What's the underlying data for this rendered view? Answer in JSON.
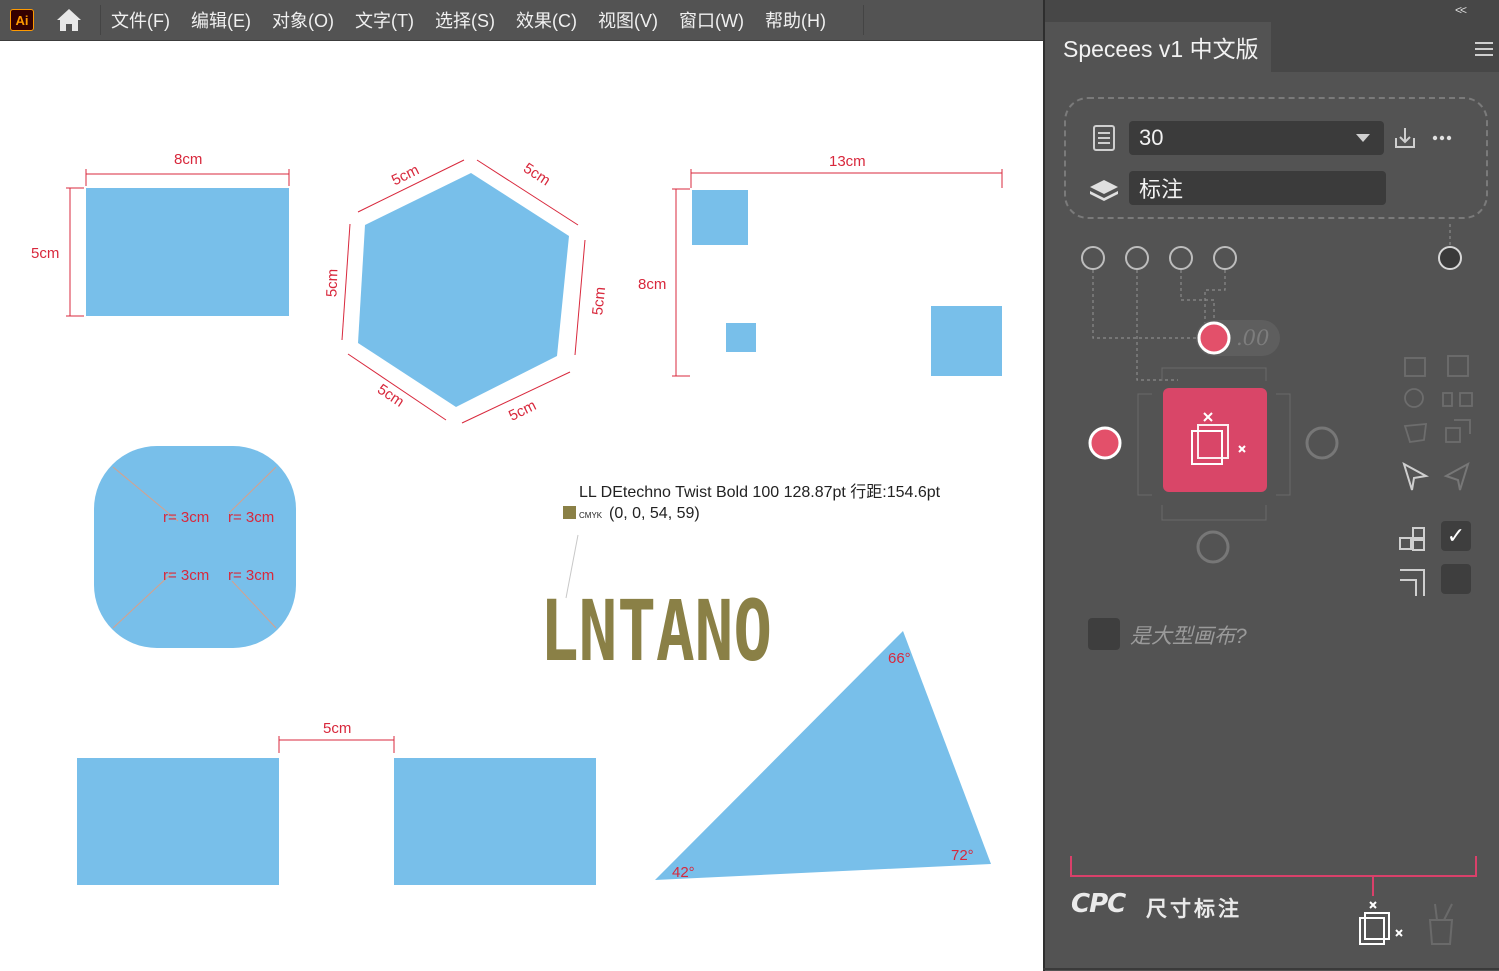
{
  "app": {
    "logo": "Ai"
  },
  "menu": [
    "文件(F)",
    "编辑(E)",
    "对象(O)",
    "文字(T)",
    "选择(S)",
    "效果(C)",
    "视图(V)",
    "窗口(W)",
    "帮助(H)"
  ],
  "canvas": {
    "rect1": {
      "width_label": "8cm",
      "height_label": "5cm"
    },
    "hexagon": {
      "side_labels": [
        "5cm",
        "5cm",
        "5cm",
        "5cm",
        "5cm",
        "5cm"
      ]
    },
    "spread": {
      "width_label": "13cm",
      "height_label": "8cm"
    },
    "rounded": {
      "radius_labels": [
        "r= 3cm",
        "r= 3cm",
        "r= 3cm",
        "r= 3cm"
      ]
    },
    "gap": {
      "label": "5cm"
    },
    "font_info": {
      "line1": "LL DEtechno Twist Bold 100 128.87pt 行距:154.6pt",
      "cmyk_tag": "CMYK",
      "cmyk_value": "(0, 0, 54, 59)",
      "swatch_color": "#8a8046"
    },
    "sample_text": "LNTANO",
    "triangle": {
      "angles": [
        "66°",
        "72°",
        "42°"
      ]
    },
    "shape_color": "#78bfea",
    "dim_color": "#d8283c"
  },
  "panel": {
    "title": "Specees v1 中文版",
    "collapse": "<<",
    "font_size": "30",
    "layer": "标注",
    "decimal": ".00",
    "large_canvas_label": "是大型画布?",
    "brand_logo": "CPC",
    "brand_text": "尺寸标注",
    "accent_color": "#e3506a",
    "apply_check": "✓"
  }
}
